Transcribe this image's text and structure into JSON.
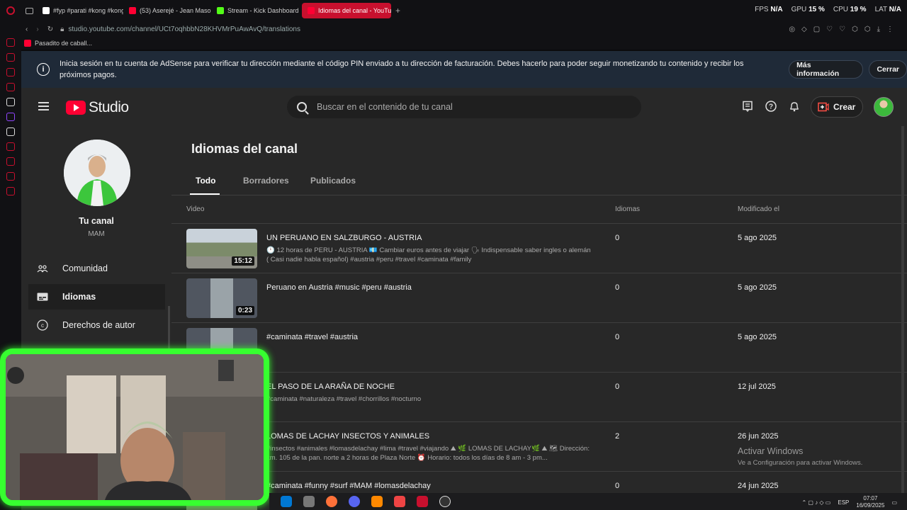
{
  "browser": {
    "tabs": [
      {
        "label": "#fyp #parati #kong #kong",
        "color": "#ffffff"
      },
      {
        "label": "(53) Aserejé - Jean Maso",
        "color": "#ff0033"
      },
      {
        "label": "Stream - Kick Dashboard",
        "color": "#53fc18"
      },
      {
        "label": "Idiomas del canal - YouTu",
        "color": "#ff0033"
      }
    ],
    "url": "studio.youtube.com/channel/UCt7oqhbbN28KHVMrPuAwAvQ/translations",
    "bookmark": "Pasadito de caball...",
    "perf": {
      "fps_label": "FPS",
      "fps": "N/A",
      "gpu_label": "GPU",
      "gpu": "15 %",
      "cpu_label": "CPU",
      "cpu": "19 %",
      "lat_label": "LAT",
      "lat": "N/A"
    }
  },
  "banner": {
    "text": "Inicia sesión en tu cuenta de AdSense para verificar tu dirección mediante el código PIN enviado a tu dirección de facturación. Debes hacerlo para poder seguir monetizando tu contenido y recibir los próximos pagos.",
    "more_info": "Más información",
    "close": "Cerrar"
  },
  "header": {
    "logo_text": "Studio",
    "search_placeholder": "Buscar en el contenido de tu canal",
    "create_label": "Crear"
  },
  "sidebar": {
    "your_channel": "Tu canal",
    "channel_name": "MAM",
    "items": [
      {
        "label": "Comunidad",
        "icon": "community-icon"
      },
      {
        "label": "Idiomas",
        "icon": "subtitles-icon",
        "active": true
      },
      {
        "label": "Derechos de autor",
        "icon": "copyright-icon"
      }
    ]
  },
  "main": {
    "title": "Idiomas del canal",
    "tabs": [
      "Todo",
      "Borradores",
      "Publicados"
    ],
    "columns": {
      "video": "Video",
      "languages": "Idiomas",
      "modified": "Modificado el"
    },
    "rows": [
      {
        "title": "UN PERUANO EN SALZBURGO - AUSTRIA",
        "desc": "🕛 12 horas de PERU - AUSTRIA 💶 Cambiar euros antes de viajar 🗣 Indispensable saber ingles o alemán ( Casi nadie habla español) #austria #peru #travel #caminata #family",
        "duration": "15:12",
        "languages": "0",
        "modified": "5 ago 2025"
      },
      {
        "title": "Peruano en Austria #music #peru #austria",
        "desc": "",
        "duration": "0:23",
        "languages": "0",
        "modified": "5 ago 2025"
      },
      {
        "title": "#caminata #travel #austria",
        "desc": "",
        "duration": "",
        "languages": "0",
        "modified": "5 ago 2025"
      },
      {
        "title": "EL PASO DE LA ARAÑA DE NOCHE",
        "desc": "#caminata #naturaleza #travel #chorrillos #nocturno",
        "duration": "",
        "languages": "0",
        "modified": "12 jul 2025"
      },
      {
        "title": "LOMAS DE LACHAY INSECTOS Y ANIMALES",
        "desc": "#insectos #animales #lomasdelachay #lima #travel #viajando ⛰ 🌿 LOMAS DE LACHAY🌿 ⛰ 🗺 Dirección: km. 105 de la pan. norte a 2 horas de Plaza Norte ⏰ Horario: todos los días de 8 am - 3 pm...",
        "duration": "",
        "languages": "2",
        "modified": "26 jun 2025"
      },
      {
        "title": "#caminata #funny #surf #MAM #lomasdelachay",
        "desc": "",
        "duration": "",
        "languages": "0",
        "modified": "24 jun 2025"
      }
    ]
  },
  "windows_watermark": {
    "title": "Activar Windows",
    "subtitle": "Ve a Configuración para activar Windows."
  },
  "taskbar": {
    "lang": "ESP",
    "time": "07:07",
    "date": "16/09/2025"
  }
}
